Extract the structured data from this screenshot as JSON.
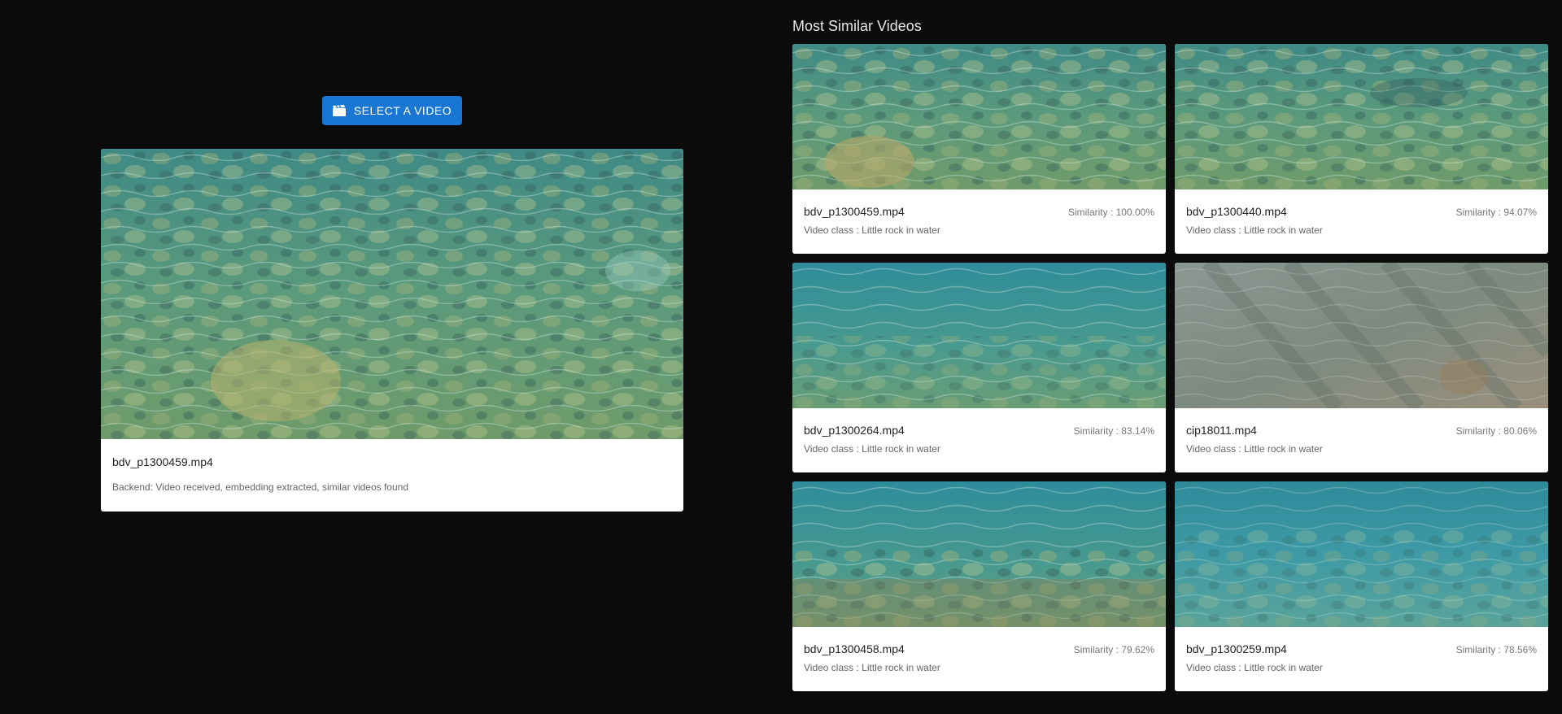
{
  "upload": {
    "button_label": "SELECT A VIDEO",
    "button_icon": "clapperboard-icon",
    "accent_color": "#1976d2"
  },
  "query": {
    "filename": "bdv_p1300459.mp4",
    "status": "Backend: Video received, embedding extracted, similar videos found"
  },
  "results": {
    "title": "Most Similar Videos",
    "items": [
      {
        "filename": "bdv_p1300459.mp4",
        "similarity": "Similarity : 100.00%",
        "video_class": "Video class : Little rock in water"
      },
      {
        "filename": "bdv_p1300440.mp4",
        "similarity": "Similarity : 94.07%",
        "video_class": "Video class : Little rock in water"
      },
      {
        "filename": "bdv_p1300264.mp4",
        "similarity": "Similarity : 83.14%",
        "video_class": "Video class : Little rock in water"
      },
      {
        "filename": "cip18011.mp4",
        "similarity": "Similarity : 80.06%",
        "video_class": "Video class : Little rock in water"
      },
      {
        "filename": "bdv_p1300458.mp4",
        "similarity": "Similarity : 79.62%",
        "video_class": "Video class : Little rock in water"
      },
      {
        "filename": "bdv_p1300259.mp4",
        "similarity": "Similarity : 78.56%",
        "video_class": "Video class : Little rock in water"
      }
    ]
  }
}
